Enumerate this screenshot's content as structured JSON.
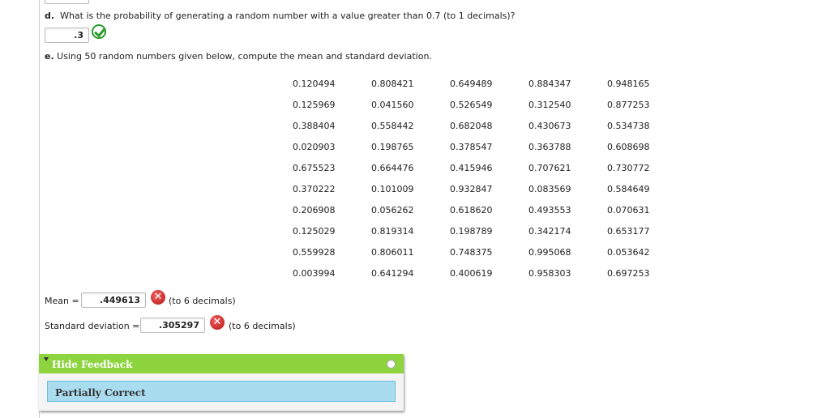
{
  "question_d": {
    "letter": "d.",
    "text": "What is the probability of generating a random number with a value greater than 0.7 (to 1 decimals)?",
    "answer": ".3",
    "status_icon": "check-circle-icon"
  },
  "question_e": {
    "letter": "e.",
    "text": "Using 50 random numbers given below, compute the mean and standard deviation.",
    "table": [
      [
        "0.120494",
        "0.808421",
        "0.649489",
        "0.884347",
        "0.948165"
      ],
      [
        "0.125969",
        "0.041560",
        "0.526549",
        "0.312540",
        "0.877253"
      ],
      [
        "0.388404",
        "0.558442",
        "0.682048",
        "0.430673",
        "0.534738"
      ],
      [
        "0.020903",
        "0.198765",
        "0.378547",
        "0.363788",
        "0.608698"
      ],
      [
        "0.675523",
        "0.664476",
        "0.415946",
        "0.707621",
        "0.730772"
      ],
      [
        "0.370222",
        "0.101009",
        "0.932847",
        "0.083569",
        "0.584649"
      ],
      [
        "0.206908",
        "0.056262",
        "0.618620",
        "0.493553",
        "0.070631"
      ],
      [
        "0.125029",
        "0.819314",
        "0.198789",
        "0.342174",
        "0.653177"
      ],
      [
        "0.559928",
        "0.806011",
        "0.748375",
        "0.995068",
        "0.053642"
      ],
      [
        "0.003994",
        "0.641294",
        "0.400619",
        "0.958303",
        "0.697253"
      ]
    ],
    "mean": {
      "label": "Mean =",
      "value": ".449613",
      "hint": "(to 6 decimals)",
      "status_icon": "x-circle-icon",
      "status_symbol": "✕"
    },
    "sd": {
      "label": "Standard deviation =",
      "value": ".305297",
      "hint": "(to 6 decimals)",
      "status_icon": "x-circle-icon",
      "status_symbol": "✕"
    }
  },
  "feedback": {
    "toggle_label": "Hide Feedback",
    "status": "Partially Correct"
  },
  "colors": {
    "feedback_header": "#8dd43f",
    "feedback_body": "#aadcef",
    "correct": "#2a9a2a",
    "incorrect": "#c81e1e"
  }
}
